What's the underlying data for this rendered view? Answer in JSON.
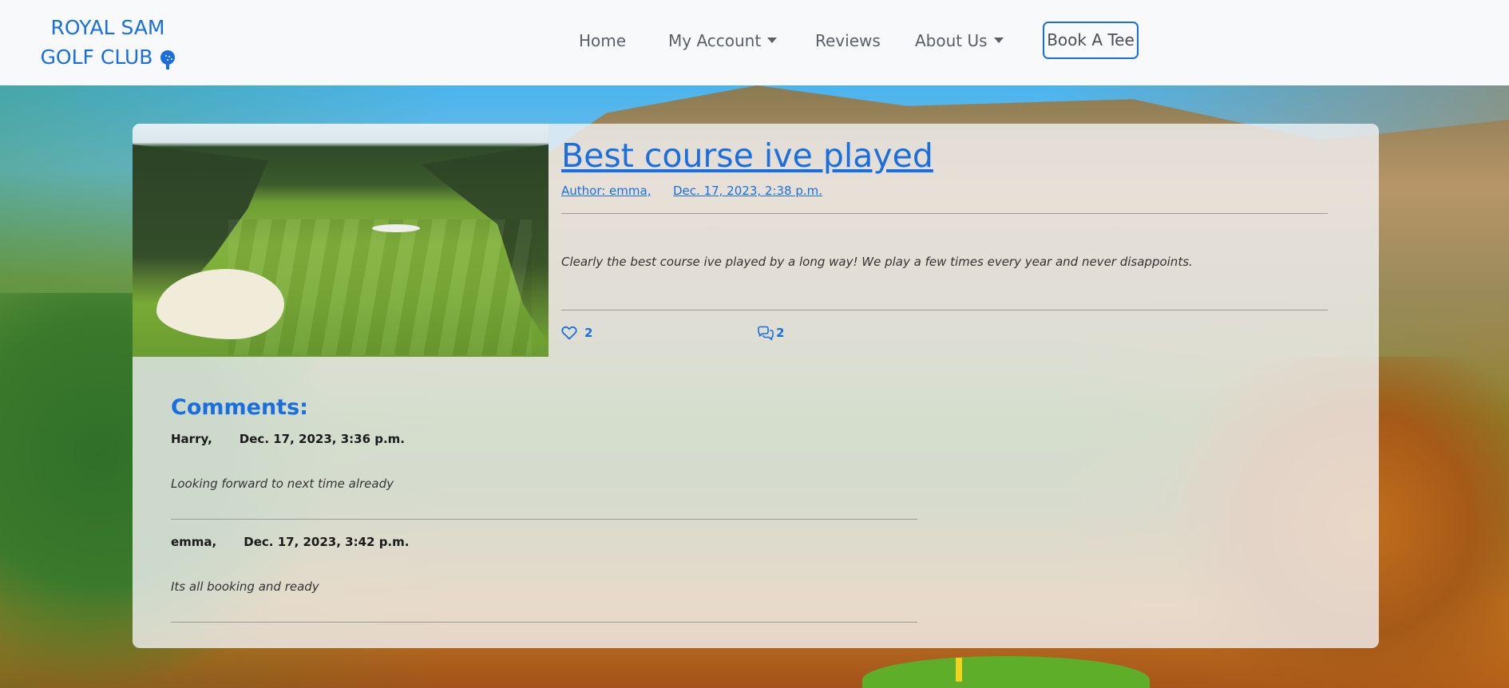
{
  "navbar": {
    "brand_line1": "ROYAL SAM",
    "brand_line2": "GOLF CLUB",
    "links": {
      "home": "Home",
      "my_account": "My Account",
      "reviews": "Reviews",
      "about_us": "About Us"
    },
    "book_button": "Book A Tee"
  },
  "post": {
    "title": "Best course ive played",
    "author": "Author: emma,",
    "date": "Dec. 17, 2023, 2:38 p.m.",
    "body": "Clearly the best course ive played by a long way! We play a few times every year and never disappoints.",
    "likes": "2",
    "comments_count": "2"
  },
  "comments": {
    "heading": "Comments:",
    "items": [
      {
        "author": "Harry,",
        "date": "Dec. 17, 2023, 3:36 p.m.",
        "body": "Looking forward to next time already"
      },
      {
        "author": "emma,",
        "date": "Dec. 17, 2023, 3:42 p.m.",
        "body": "Its all booking and ready"
      }
    ]
  },
  "colors": {
    "accent": "#1a6fe0",
    "nav_text": "#5a5f66",
    "card_bg": "#f2f3f4"
  },
  "icons": {
    "brand": "golf-ball-on-tee-icon",
    "like": "heart-outline-icon",
    "comments": "chat-bubbles-icon",
    "dropdown": "caret-down-icon"
  }
}
